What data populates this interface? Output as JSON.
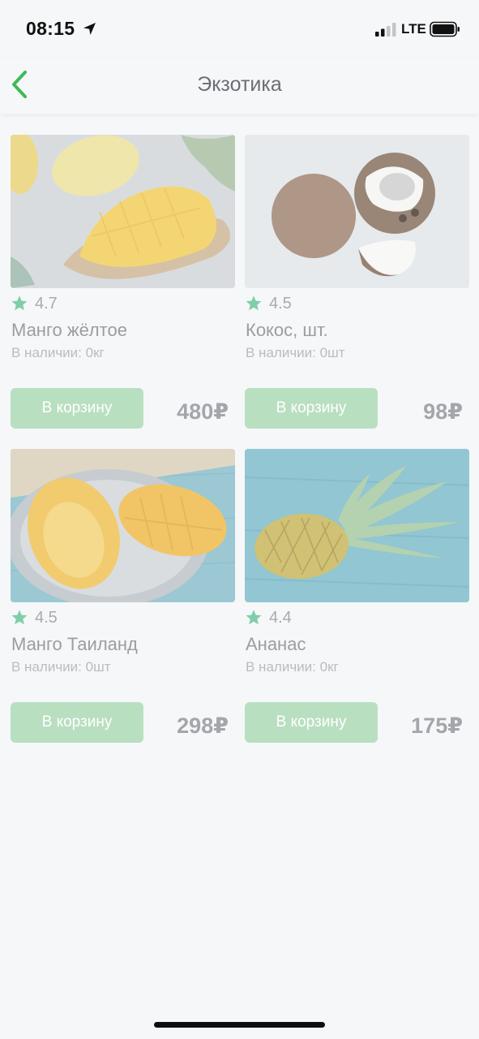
{
  "status_bar": {
    "time": "08:15",
    "network": "LTE",
    "icons": [
      "location-arrow-icon",
      "signal-icon",
      "battery-icon"
    ]
  },
  "nav": {
    "title": "Экзотика",
    "back_icon": "chevron-left-icon"
  },
  "colors": {
    "accent_green": "#3dba57",
    "button_green": "#b9dfc1",
    "star_green": "#7ecfa9",
    "background": "#f6f7f9"
  },
  "products": [
    {
      "rating": "4.7",
      "name": "Манго жёлтое",
      "stock": "В наличии: 0кг",
      "button_label": "В корзину",
      "price": "480₽",
      "image": "yellow-mango-image"
    },
    {
      "rating": "4.5",
      "name": "Кокос, шт.",
      "stock": "В наличии: 0шт",
      "button_label": "В корзину",
      "price": "98₽",
      "image": "coconut-image"
    },
    {
      "rating": "4.5",
      "name": "Манго Таиланд",
      "stock": "В наличии: 0шт",
      "button_label": "В корзину",
      "price": "298₽",
      "image": "thai-mango-image"
    },
    {
      "rating": "4.4",
      "name": "Ананас",
      "stock": "В наличии: 0кг",
      "button_label": "В корзину",
      "price": "175₽",
      "image": "pineapple-image"
    }
  ]
}
